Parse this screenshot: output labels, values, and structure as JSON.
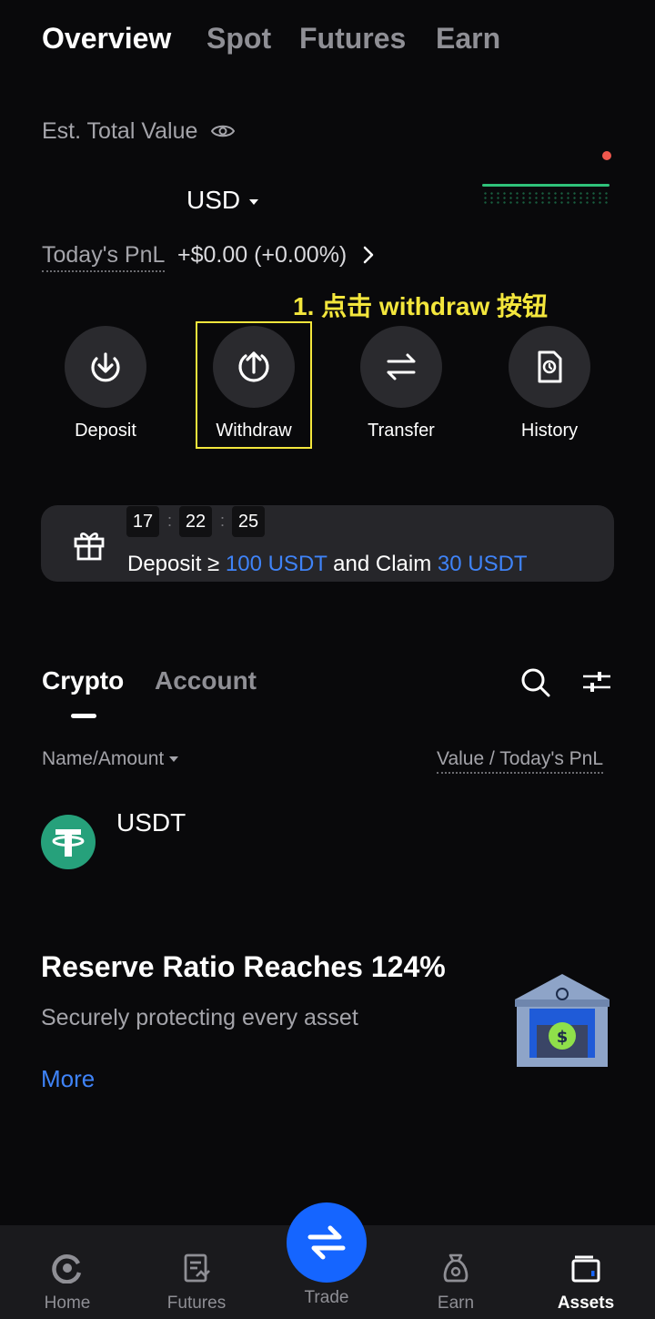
{
  "header": {
    "tabs": [
      {
        "label": "Overview",
        "active": true
      },
      {
        "label": "Spot",
        "active": false
      },
      {
        "label": "Futures",
        "active": false
      },
      {
        "label": "Earn",
        "active": false
      }
    ]
  },
  "summary": {
    "est_label": "Est. Total Value",
    "currency": "USD",
    "pnl_label": "Today's PnL",
    "pnl_value": "+$0.00 (+0.00%)"
  },
  "annotation": {
    "text": "1. 点击 withdraw 按钮",
    "color": "#f3e63c"
  },
  "actions": [
    {
      "label": "Deposit",
      "icon": "download-icon"
    },
    {
      "label": "Withdraw",
      "icon": "upload-icon"
    },
    {
      "label": "Transfer",
      "icon": "transfer-arrows-icon"
    },
    {
      "label": "History",
      "icon": "history-document-icon"
    }
  ],
  "promo": {
    "timer": [
      "17",
      "22",
      "25"
    ],
    "text_prefix": "Deposit ≥ ",
    "amount1": "100 USDT",
    "text_middle": " and Claim ",
    "amount2": "30 USDT",
    "icon": "gift-icon"
  },
  "assets": {
    "tabs": [
      {
        "label": "Crypto",
        "active": true
      },
      {
        "label": "Account",
        "active": false
      }
    ],
    "name_amount_label": "Name/Amount",
    "value_pnl_label": "Value / Today's PnL",
    "items": [
      {
        "symbol": "USDT",
        "icon": "tether-icon"
      }
    ]
  },
  "reserve": {
    "title": "Reserve Ratio Reaches 124%",
    "subtitle": "Securely protecting every asset",
    "more": "More",
    "icon": "bank-vault-icon"
  },
  "bottom_nav": [
    {
      "label": "Home",
      "icon": "home-icon",
      "active": false
    },
    {
      "label": "Futures",
      "icon": "futures-icon",
      "active": false
    },
    {
      "label": "Trade",
      "icon": "trade-icon",
      "active": false
    },
    {
      "label": "Earn",
      "icon": "earn-icon",
      "active": false
    },
    {
      "label": "Assets",
      "icon": "wallet-icon",
      "active": true
    }
  ],
  "colors": {
    "background": "#09090b",
    "accent_blue": "#3f83f8",
    "trade_button": "#1565ff",
    "usdt_green": "#26a17b"
  }
}
